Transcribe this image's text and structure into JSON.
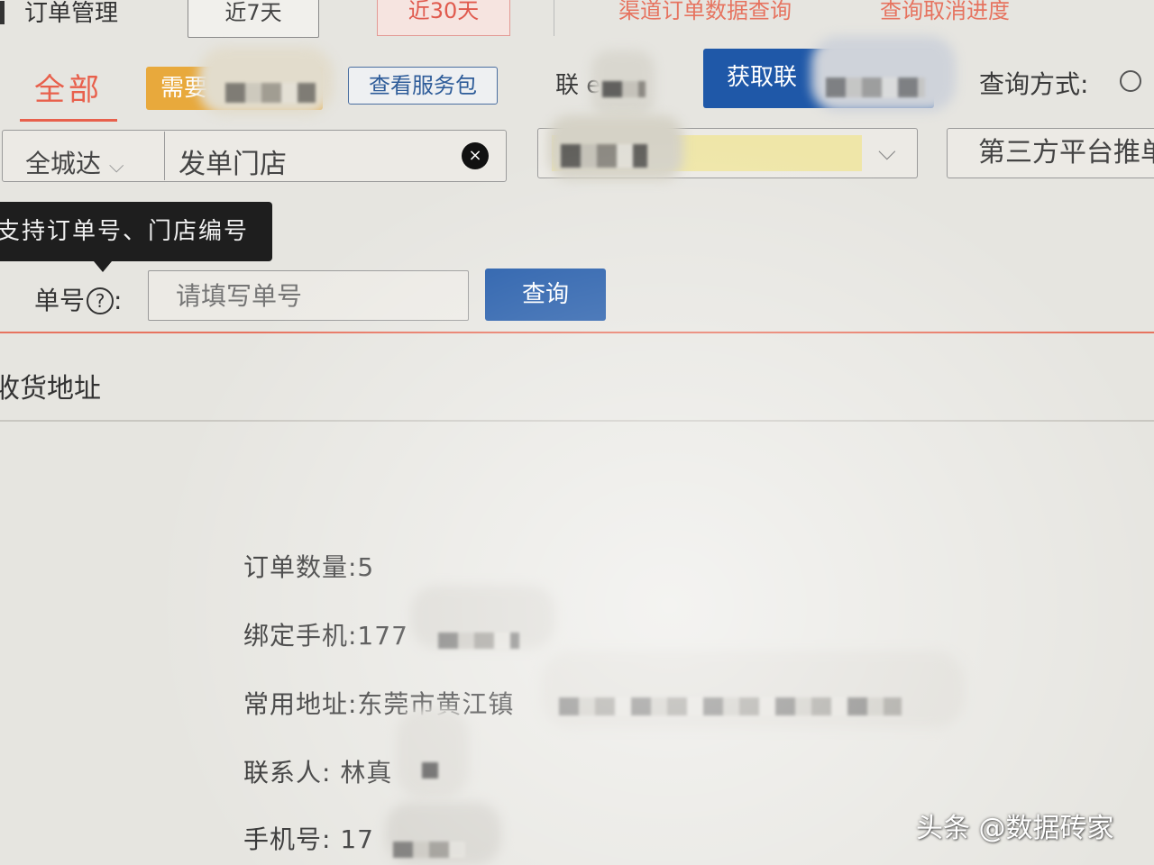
{
  "top": {
    "title": "订单管理",
    "range_7": "近7天",
    "range_30": "近30天",
    "link_channel": "渠道订单数据查询",
    "link_cancel": "查询取消进度"
  },
  "tabs": {
    "all": "全部",
    "badge": "需要",
    "view_package": "查看服务包",
    "contact_label": "联 en:",
    "get_button": "获取联",
    "query_mode_label": "查询方式:"
  },
  "filters": {
    "carrier": "全城达",
    "store": "发单门店",
    "clear_icon": "×",
    "platform": "第三方平台推单"
  },
  "search": {
    "tooltip": "支持订单号、门店编号",
    "order_label": "单号",
    "help_icon": "?",
    "placeholder": "请填写单号",
    "query_button": "查询"
  },
  "section_title": "收货地址",
  "info": {
    "order_count": "订单数量:5",
    "bound_phone": "绑定手机:177",
    "address": "常用地址:东莞市黄江镇",
    "contact": "联系人: 林真",
    "phone": "手机号: 17"
  },
  "watermark": "头条 @数据砖家",
  "colors": {
    "accent_red": "#e8604c",
    "brand_blue": "#1f58a8",
    "badge_orange": "#e8a93c"
  }
}
